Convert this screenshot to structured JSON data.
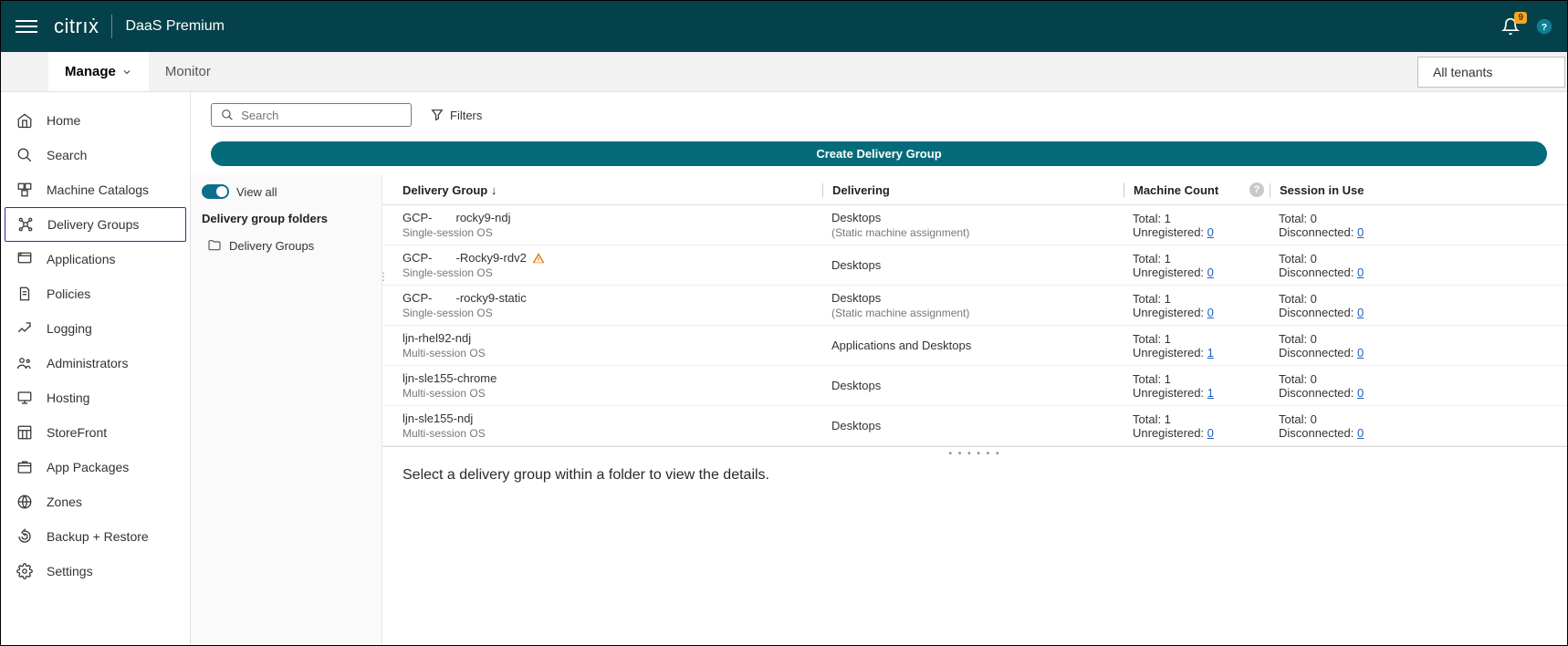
{
  "header": {
    "logo_text": "citrıẋ",
    "product": "DaaS Premium",
    "notification_count": "9"
  },
  "subnav": {
    "tabs": [
      {
        "label": "Manage",
        "active": true
      },
      {
        "label": "Monitor",
        "active": false
      }
    ],
    "tenants_label": "All tenants"
  },
  "sidebar": {
    "items": [
      {
        "label": "Home"
      },
      {
        "label": "Search"
      },
      {
        "label": "Machine Catalogs"
      },
      {
        "label": "Delivery Groups"
      },
      {
        "label": "Applications"
      },
      {
        "label": "Policies"
      },
      {
        "label": "Logging"
      },
      {
        "label": "Administrators"
      },
      {
        "label": "Hosting"
      },
      {
        "label": "StoreFront"
      },
      {
        "label": "App Packages"
      },
      {
        "label": "Zones"
      },
      {
        "label": "Backup + Restore"
      },
      {
        "label": "Settings"
      }
    ]
  },
  "toolbar": {
    "search_placeholder": "Search",
    "filters_label": "Filters",
    "create_label": "Create Delivery Group"
  },
  "folder_panel": {
    "view_all_label": "View all",
    "header": "Delivery group folders",
    "items": [
      {
        "label": "Delivery Groups"
      }
    ]
  },
  "table": {
    "headers": {
      "dg": "Delivery Group",
      "delivering": "Delivering",
      "machine_count": "Machine Count",
      "session_in_use": "Session in Use"
    },
    "rows": [
      {
        "name": "GCP-  rocky9-ndj",
        "os": "Single-session OS",
        "delivering": "Desktops",
        "delivering_sub": "(Static machine assignment)",
        "mc_total": "Total: 1",
        "mc_unreg_label": "Unregistered: ",
        "mc_unreg_val": "0",
        "si_total": "Total: 0",
        "si_disc_label": "Disconnected: ",
        "si_disc_val": "0",
        "warning": false
      },
      {
        "name": "GCP-  -Rocky9-rdv2",
        "os": "Single-session OS",
        "delivering": "Desktops",
        "delivering_sub": "",
        "mc_total": "Total: 1",
        "mc_unreg_label": "Unregistered: ",
        "mc_unreg_val": "0",
        "si_total": "Total: 0",
        "si_disc_label": "Disconnected: ",
        "si_disc_val": "0",
        "warning": true
      },
      {
        "name": "GCP-  -rocky9-static",
        "os": "Single-session OS",
        "delivering": "Desktops",
        "delivering_sub": "(Static machine assignment)",
        "mc_total": "Total: 1",
        "mc_unreg_label": "Unregistered: ",
        "mc_unreg_val": "0",
        "si_total": "Total: 0",
        "si_disc_label": "Disconnected: ",
        "si_disc_val": "0",
        "warning": false
      },
      {
        "name": "ljn-rhel92-ndj",
        "os": "Multi-session OS",
        "delivering": "Applications and Desktops",
        "delivering_sub": "",
        "mc_total": "Total: 1",
        "mc_unreg_label": "Unregistered: ",
        "mc_unreg_val": "1",
        "si_total": "Total: 0",
        "si_disc_label": "Disconnected: ",
        "si_disc_val": "0",
        "warning": false
      },
      {
        "name": "ljn-sle155-chrome",
        "os": "Multi-session OS",
        "delivering": "Desktops",
        "delivering_sub": "",
        "mc_total": "Total: 1",
        "mc_unreg_label": "Unregistered: ",
        "mc_unreg_val": "1",
        "si_total": "Total: 0",
        "si_disc_label": "Disconnected: ",
        "si_disc_val": "0",
        "warning": false
      },
      {
        "name": "ljn-sle155-ndj",
        "os": "Multi-session OS",
        "delivering": "Desktops",
        "delivering_sub": "",
        "mc_total": "Total: 1",
        "mc_unreg_label": "Unregistered: ",
        "mc_unreg_val": "0",
        "si_total": "Total: 0",
        "si_disc_label": "Disconnected: ",
        "si_disc_val": "0",
        "warning": false
      }
    ]
  },
  "detail_message": "Select a delivery group within a folder to view the details."
}
